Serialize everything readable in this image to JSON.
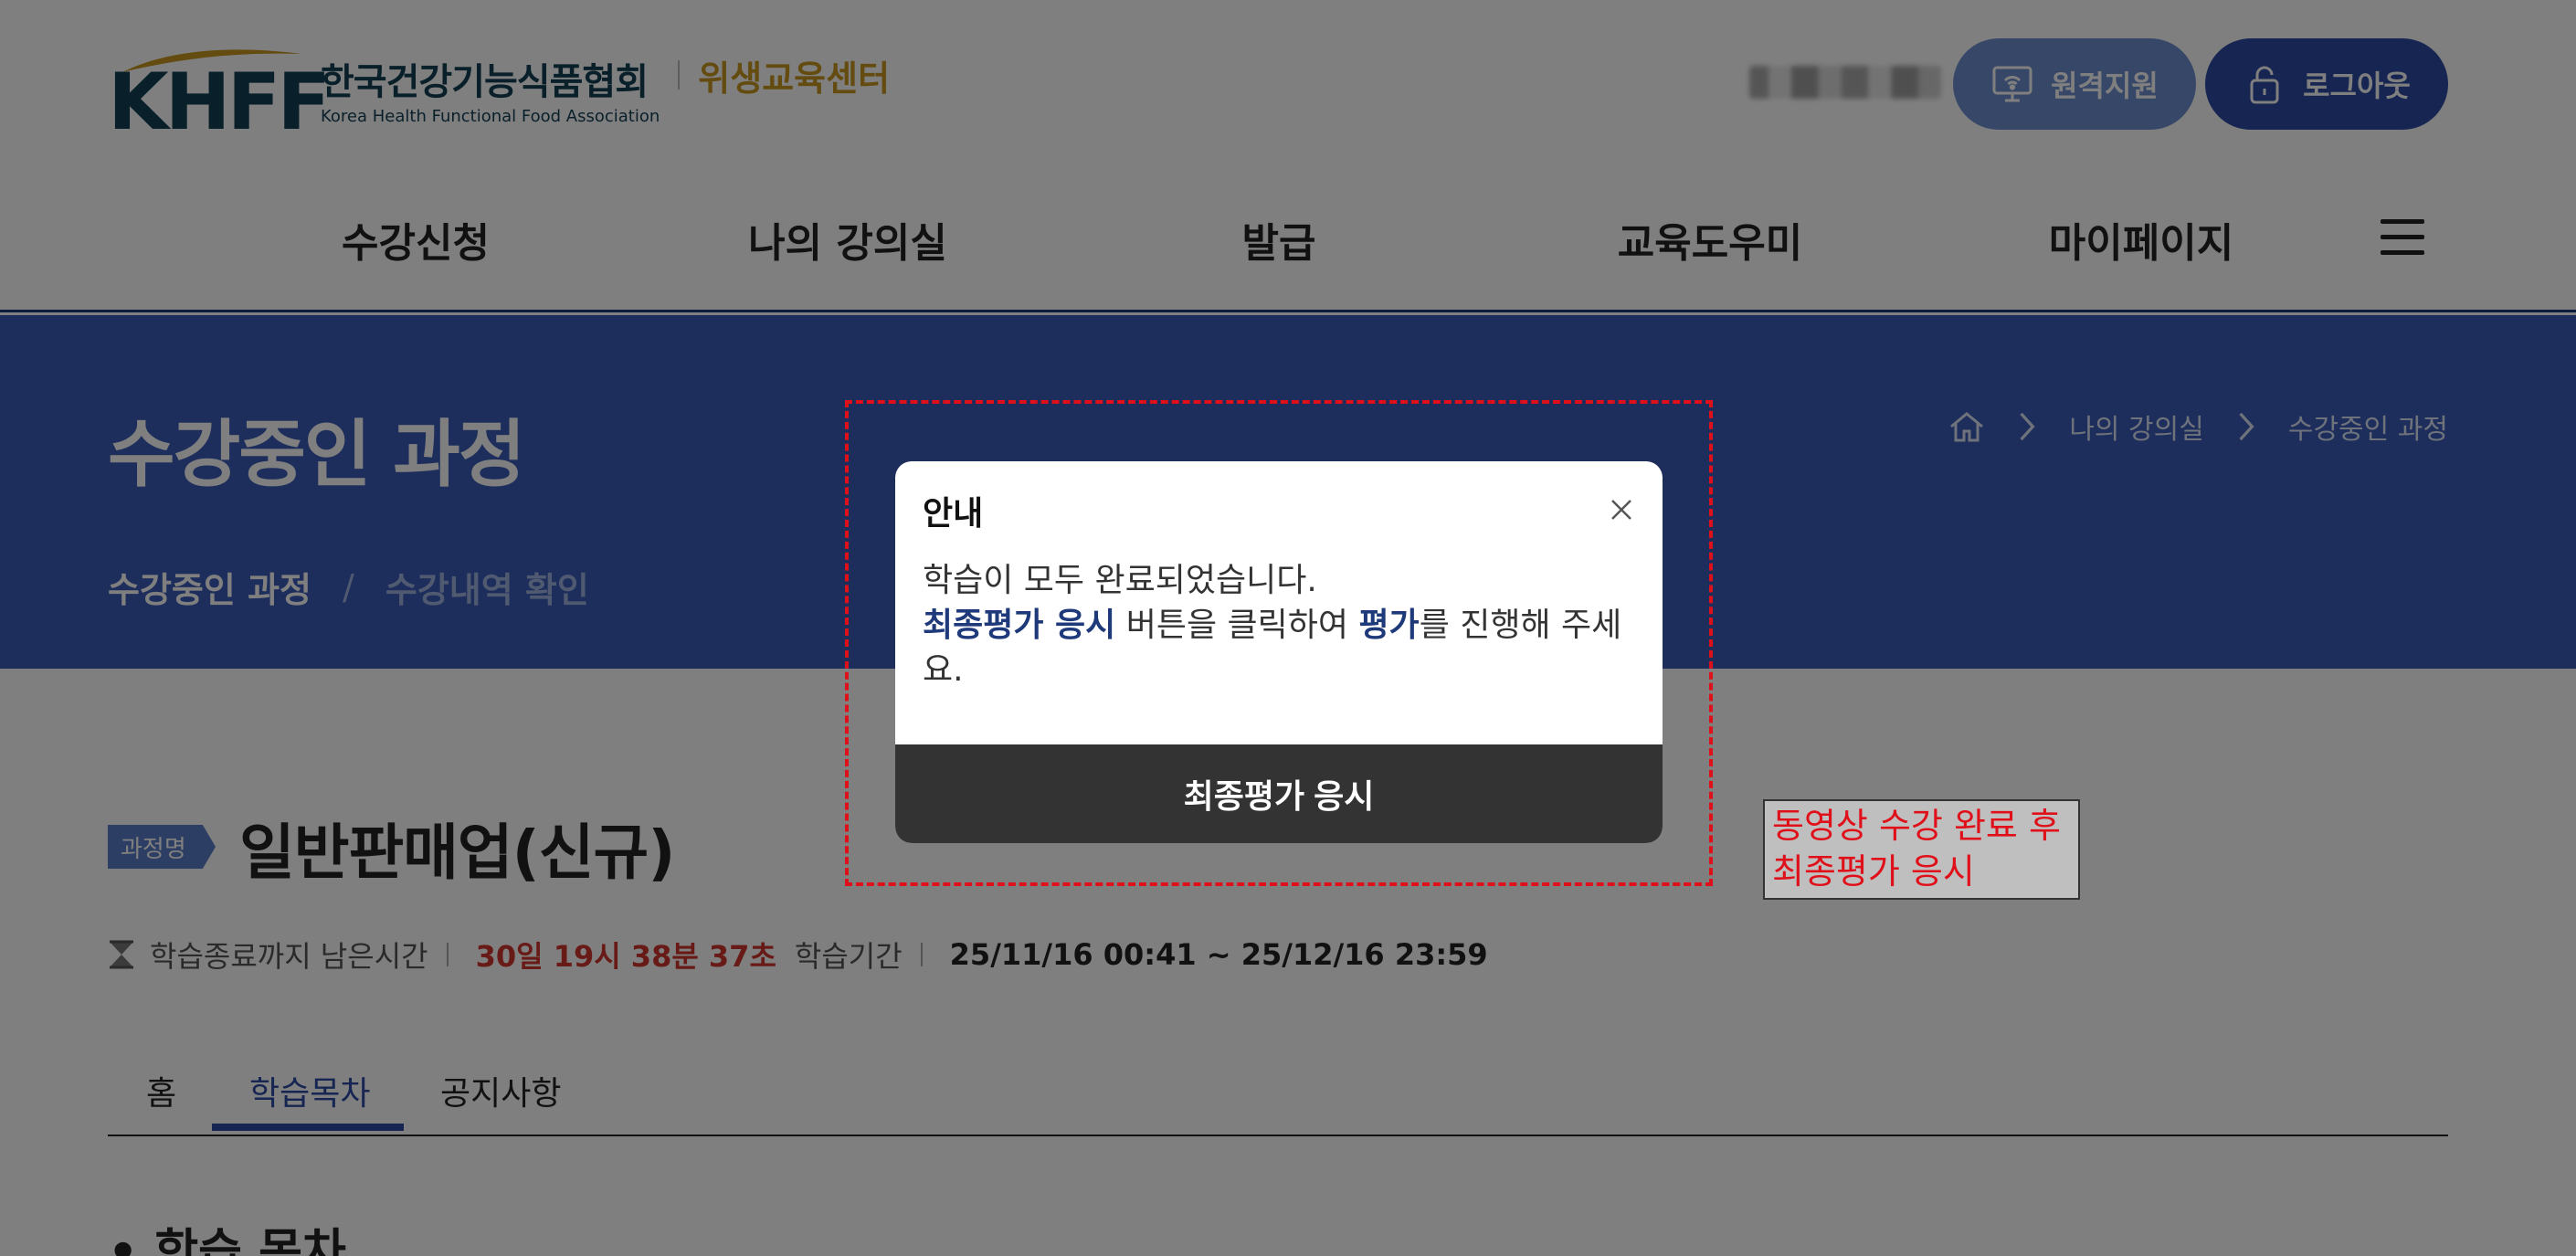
{
  "header": {
    "logo_mark": "KHFF",
    "logo_kr": "한국건강기능식품협회",
    "logo_en": "Korea Health Functional Food Association",
    "logo_center": "위생교육센터",
    "remote_label": "원격지원",
    "logout_label": "로그아웃"
  },
  "nav": {
    "items": [
      "수강신청",
      "나의 강의실",
      "발급",
      "교육도우미",
      "마이페이지"
    ]
  },
  "banner": {
    "title": "수강중인 과정",
    "subtabs": [
      "수강중인 과정",
      "수강내역 확인"
    ],
    "subtab_sep": "/",
    "breadcrumb": [
      "나의 강의실",
      "수강중인 과정"
    ]
  },
  "course": {
    "badge": "과정명",
    "name": "일반판매업(신규)",
    "remain_label": "학습종료까지 남은시간",
    "remain_value": "30일 19시 38분 37초",
    "period_label": "학습기간",
    "period_value": "25/11/16 00:41 ~ 25/12/16 23:59"
  },
  "tabs": [
    "홈",
    "학습목차",
    "공지사항"
  ],
  "section_title": "• 학습 목차",
  "modal": {
    "title": "안내",
    "line1": "학습이 모두 완료되었습니다.",
    "em1": "최종평가 응시",
    "mid": " 버튼을 클릭하여 ",
    "em2": "평가",
    "tail": "를 진행해 주세요.",
    "button": "최종평가 응시"
  },
  "annotation": "동영상 수강 완료 후\n최종평가 응시",
  "colors": {
    "primary": "#2c4aa2",
    "banner": "#3a5bb8",
    "accent_gold": "#c8961e",
    "alert_red": "#d0342c",
    "modal_button": "#333333",
    "annotation_red": "#e0101a"
  },
  "icons": {
    "remote": "monitor-wifi-icon",
    "logout": "lock-icon",
    "home": "home-icon",
    "timer": "hourglass-icon",
    "close": "close-icon",
    "menu": "hamburger-menu-icon"
  }
}
